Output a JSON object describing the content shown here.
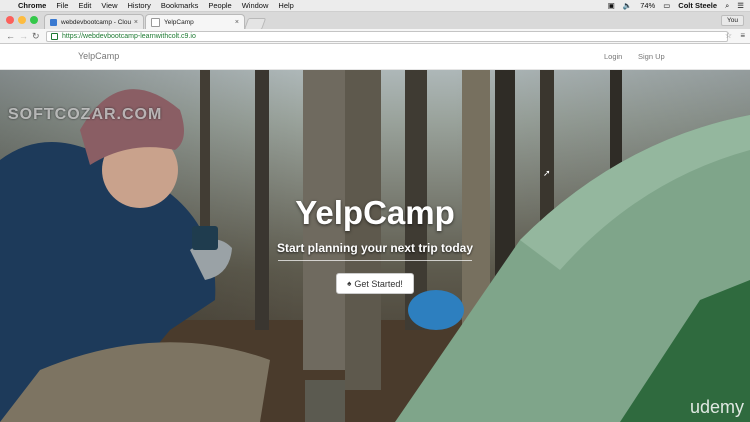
{
  "menubar": {
    "app": "Chrome",
    "items": [
      "File",
      "Edit",
      "View",
      "History",
      "Bookmarks",
      "People",
      "Window",
      "Help"
    ],
    "battery": "74%",
    "user": "Colt Steele"
  },
  "browser": {
    "tabs": [
      {
        "title": "webdevbootcamp - Cloud9",
        "active": false
      },
      {
        "title": "YelpCamp",
        "active": true
      }
    ],
    "profile_label": "You",
    "url": "https://webdevbootcamp-learnwithcolt.c9.io"
  },
  "navbar": {
    "brand": "YelpCamp",
    "links": [
      "Login",
      "Sign Up"
    ]
  },
  "hero": {
    "title": "YelpCamp",
    "subtitle": "Start planning your next trip today",
    "button": "Get Started!"
  },
  "watermark": "SOFTCOZAR.COM",
  "branding": "udemy",
  "colors": {
    "tent": "#7fa58a",
    "coat": "#1d3a5a",
    "hat": "#8a5e64"
  }
}
